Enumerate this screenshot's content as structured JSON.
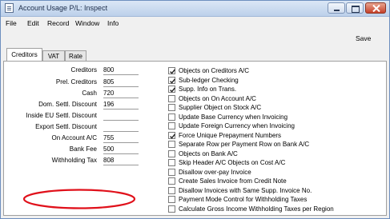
{
  "window": {
    "title": "Account Usage P/L: Inspect"
  },
  "menu": [
    "File",
    "Edit",
    "Record",
    "Window",
    "Info"
  ],
  "toolbar": {
    "save_label": "Save"
  },
  "tabs": [
    "Creditors",
    "VAT",
    "Rate"
  ],
  "active_tab": "Creditors",
  "fields": [
    {
      "label": "Creditors",
      "value": "800"
    },
    {
      "label": "Prel. Creditors",
      "value": "805"
    },
    {
      "label": "Cash",
      "value": "720"
    },
    {
      "label": "Dom. Settl. Discount",
      "value": "196"
    },
    {
      "label": "Inside EU  Settl. Discount",
      "value": ""
    },
    {
      "label": "Export Settl. Discount",
      "value": ""
    },
    {
      "label": "On Account A/C",
      "value": "755"
    },
    {
      "label": "Bank Fee",
      "value": "500"
    },
    {
      "label": "Withholding Tax",
      "value": "808"
    }
  ],
  "checkboxes": [
    {
      "label": "Objects on Creditors A/C",
      "checked": true
    },
    {
      "label": "Sub-ledger Checking",
      "checked": true
    },
    {
      "label": "Supp. Info on Trans.",
      "checked": true
    },
    {
      "label": "Objects on On Account A/C",
      "checked": false
    },
    {
      "label": "Supplier Object on Stock A/C",
      "checked": false
    },
    {
      "label": "Update Base Currency when Invoicing",
      "checked": false
    },
    {
      "label": "Update Foreign Currency when Invoicing",
      "checked": false
    },
    {
      "label": "Force Unique Prepayment Numbers",
      "checked": true
    },
    {
      "label": "Separate Row per Payment Row on Bank A/C",
      "checked": false
    },
    {
      "label": "Objects on Bank A/C",
      "checked": false
    },
    {
      "label": "Skip Header A/C Objects on Cost A/C",
      "checked": false
    },
    {
      "label": "Disallow over-pay Invoice",
      "checked": false
    },
    {
      "label": "Create Sales Invoice from Credit Note",
      "checked": false
    },
    {
      "label": "Disallow Invoices with Same Supp. Invoice No.",
      "checked": false
    },
    {
      "label": "Payment Mode Control for Withholding Taxes",
      "checked": false
    },
    {
      "label": "Calculate Gross Income Withholding Taxes per Region",
      "checked": false
    }
  ],
  "colors": {
    "title_bar": "#bcd0ea",
    "close_button": "#c6412a",
    "highlight": "#e0101a"
  }
}
